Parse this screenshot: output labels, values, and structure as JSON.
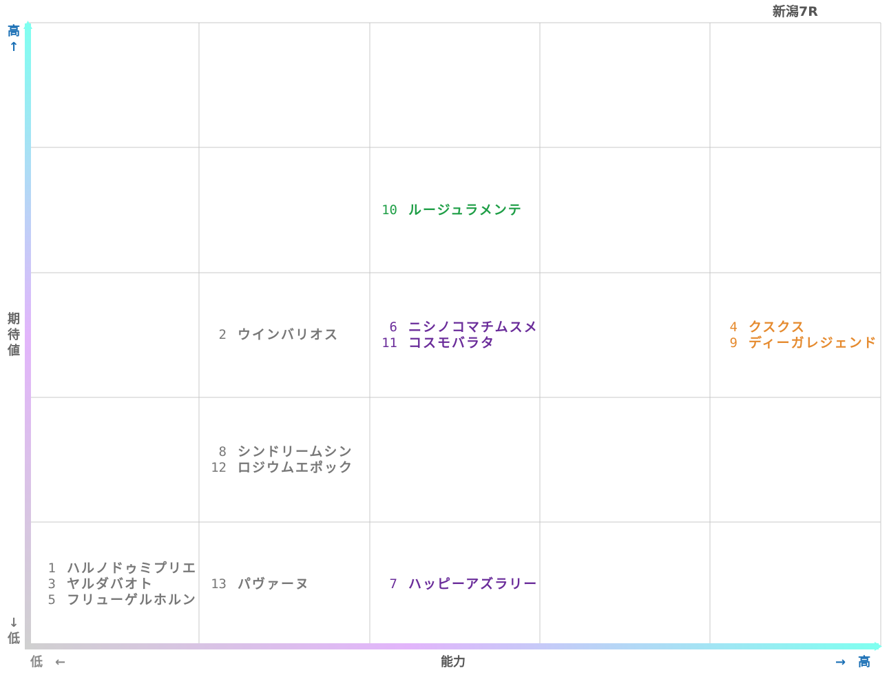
{
  "title": "新潟7R",
  "axes": {
    "y_name": "期待値",
    "y_name_chars": [
      "期",
      "待",
      "値"
    ],
    "y_high": "高",
    "y_high_arrow": "↑",
    "y_low_arrow": "↓",
    "y_low": "低",
    "x_name": "能力",
    "x_low": "低　←",
    "x_high": "→　高"
  },
  "colors": {
    "grid": "#c8c8c8",
    "gray": "#777777",
    "green": "#1e9e46",
    "purple": "#6a2c9a",
    "orange": "#e58a2e",
    "y_axis_gradient": [
      "#7ffff0",
      "#e2b5fb",
      "#d0d0d0"
    ],
    "x_axis_gradient": [
      "#d0d0d0",
      "#e2b5fb",
      "#7ffff0"
    ]
  },
  "chart_data": {
    "type": "table",
    "grid": {
      "columns": 5,
      "rows": 5
    },
    "x_axis": "能力",
    "y_axis": "期待値",
    "entries": [
      {
        "col": 2,
        "row": 1,
        "color": "green",
        "horses": [
          {
            "num": "10",
            "name": "ルージュラメンテ"
          }
        ]
      },
      {
        "col": 1,
        "row": 2,
        "color": "gray",
        "horses": [
          {
            "num": "2",
            "name": "ウインバリオス"
          }
        ]
      },
      {
        "col": 2,
        "row": 2,
        "color": "purple",
        "horses": [
          {
            "num": "6",
            "name": "ニシノコマチムスメ"
          },
          {
            "num": "11",
            "name": "コスモバラタ"
          }
        ]
      },
      {
        "col": 4,
        "row": 2,
        "color": "orange",
        "horses": [
          {
            "num": "4",
            "name": "クスクス"
          },
          {
            "num": "9",
            "name": "ディーガレジェンド"
          }
        ]
      },
      {
        "col": 1,
        "row": 3,
        "color": "gray",
        "horses": [
          {
            "num": "8",
            "name": "シンドリームシン"
          },
          {
            "num": "12",
            "name": "ロジウムエポック"
          }
        ]
      },
      {
        "col": 0,
        "row": 4,
        "color": "gray",
        "horses": [
          {
            "num": "1",
            "name": "ハルノドゥミプリエ"
          },
          {
            "num": "3",
            "name": "ヤルダバオト"
          },
          {
            "num": "5",
            "name": "フリューゲルホルン"
          }
        ]
      },
      {
        "col": 1,
        "row": 4,
        "color": "gray",
        "horses": [
          {
            "num": "13",
            "name": "パヴァーヌ"
          }
        ]
      },
      {
        "col": 2,
        "row": 4,
        "color": "purple",
        "horses": [
          {
            "num": "7",
            "name": "ハッピーアズラリー"
          }
        ]
      }
    ]
  }
}
